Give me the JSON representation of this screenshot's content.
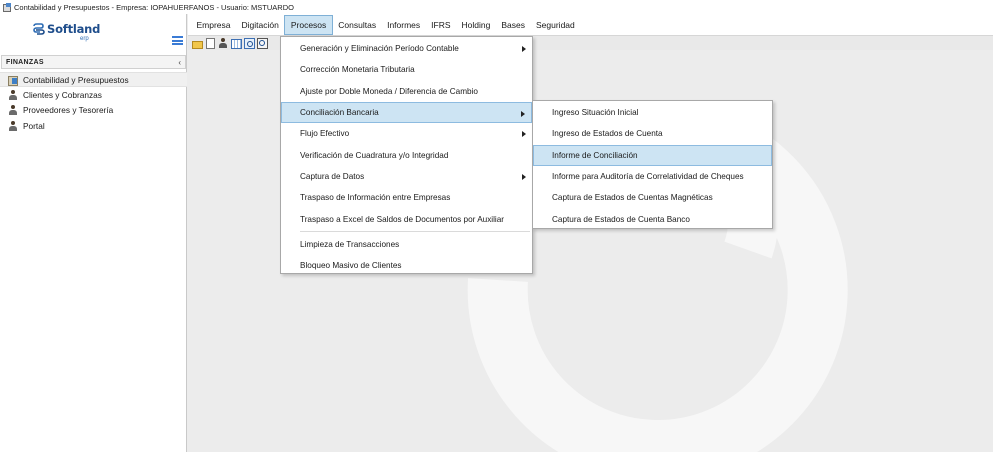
{
  "window": {
    "title": "Contabilidad y Presupuestos - Empresa: IOPAHUERFANOS - Usuario: MSTUARDO"
  },
  "logo": {
    "brand": "Softland",
    "sub": "erp"
  },
  "sidebar": {
    "section_title": "FINANZAS",
    "items": [
      {
        "label": "Contabilidad y Presupuestos",
        "icon": "calculator-icon"
      },
      {
        "label": "Clientes y Cobranzas",
        "icon": "person-icon"
      },
      {
        "label": "Proveedores y Tesorería",
        "icon": "person-icon"
      },
      {
        "label": "Portal",
        "icon": "person-icon"
      }
    ]
  },
  "menubar": {
    "items": [
      "Empresa",
      "Digitación",
      "Procesos",
      "Consultas",
      "Informes",
      "IFRS",
      "Holding",
      "Bases",
      "Seguridad"
    ],
    "active": "Procesos"
  },
  "procesos_menu": {
    "items": [
      "Generación y Eliminación Período Contable",
      "Corrección Monetaria Tributaria",
      "Ajuste por Doble Moneda / Diferencia de Cambio",
      "Conciliación Bancaria",
      "Flujo Efectivo",
      "Verificación de Cuadratura y/o Integridad",
      "Captura de Datos",
      "Traspaso de Información entre Empresas",
      "Traspaso a Excel de Saldos de Documentos por Auxiliar",
      "Limpieza de Transacciones",
      "Bloqueo Masivo de Clientes"
    ]
  },
  "conciliacion_submenu": {
    "items": [
      "Ingreso Situación Inicial",
      "Ingreso de Estados de Cuenta",
      "Informe de Conciliación",
      "Informe para Auditoría de Correlatividad de Cheques",
      "Captura de Estados de Cuentas Magnéticas",
      "Captura de Estados de Cuenta Banco"
    ]
  },
  "colors": {
    "highlight": "#cde4f3",
    "highlight_border": "#8dbbe0",
    "brand": "#1f4e8c",
    "accent": "#3a7bd5"
  }
}
